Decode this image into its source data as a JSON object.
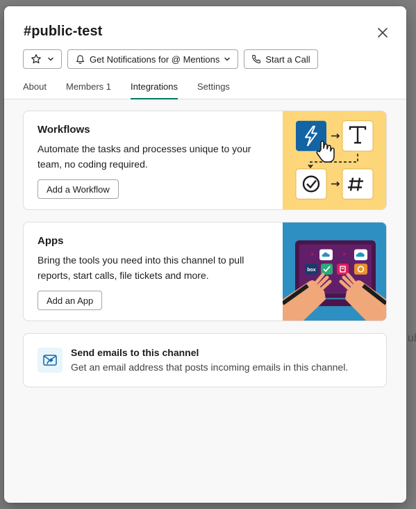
{
  "channel": {
    "hash": "#",
    "name": "public-test"
  },
  "header_actions": {
    "notifications_label": "Get Notifications for @ Mentions",
    "call_label": "Start a Call"
  },
  "tabs": [
    {
      "label": "About",
      "active": false
    },
    {
      "label": "Members 1",
      "active": false
    },
    {
      "label": "Integrations",
      "active": true
    },
    {
      "label": "Settings",
      "active": false
    }
  ],
  "workflows": {
    "title": "Workflows",
    "description": "Automate the tasks and processes unique to your team, no coding required.",
    "button": "Add a Workflow"
  },
  "apps": {
    "title": "Apps",
    "description": "Bring the tools you need into this channel to pull reports, start calls, file tickets and more.",
    "button": "Add an App",
    "tile_text_box": "box"
  },
  "email": {
    "title": "Send emails to this channel",
    "description": "Get an email address that posts incoming emails in this channel."
  },
  "backdrop": {
    "right_edge_text": "ub"
  },
  "colors": {
    "active_tab_underline": "#007a5a",
    "workflow_art_bg": "#fdd67a",
    "apps_art_bg": "#2e8fc2",
    "laptop_purple": "#4a154b",
    "email_icon_bg": "#e8f5fa",
    "email_icon_fg": "#1264a3"
  },
  "icons": [
    "star-icon",
    "chevron-down-icon",
    "bell-icon",
    "phone-icon",
    "close-icon",
    "email-forward-icon"
  ]
}
